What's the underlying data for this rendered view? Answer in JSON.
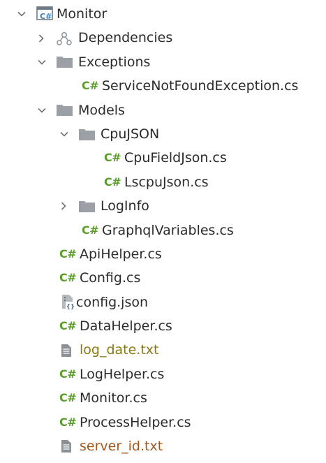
{
  "tree": {
    "root": {
      "label": "Monitor",
      "icon": "csharp-project-icon",
      "expanded": true
    },
    "dependencies": {
      "label": "Dependencies",
      "icon": "dependencies-icon",
      "expanded": false
    },
    "exceptions": {
      "label": "Exceptions",
      "icon": "folder-icon",
      "expanded": true,
      "children": [
        {
          "label": "ServiceNotFoundException.cs",
          "icon": "csharp-file-icon",
          "icon_text": "C#"
        }
      ]
    },
    "models": {
      "label": "Models",
      "icon": "folder-icon",
      "expanded": true,
      "cpujson": {
        "label": "CpuJSON",
        "icon": "folder-icon",
        "expanded": true,
        "children": [
          {
            "label": "CpuFieldJson.cs",
            "icon": "csharp-file-icon",
            "icon_text": "C#"
          },
          {
            "label": "LscpuJson.cs",
            "icon": "csharp-file-icon",
            "icon_text": "C#"
          }
        ]
      },
      "loginfo": {
        "label": "LogInfo",
        "icon": "folder-icon",
        "expanded": false
      },
      "graphql": {
        "label": "GraphqlVariables.cs",
        "icon": "csharp-file-icon",
        "icon_text": "C#"
      }
    },
    "files": [
      {
        "label": "ApiHelper.cs",
        "icon": "csharp-file-icon",
        "icon_text": "C#"
      },
      {
        "label": "Config.cs",
        "icon": "csharp-file-icon",
        "icon_text": "C#"
      },
      {
        "label": "config.json",
        "icon": "json-file-icon"
      },
      {
        "label": "DataHelper.cs",
        "icon": "csharp-file-icon",
        "icon_text": "C#"
      },
      {
        "label": "log_date.txt",
        "icon": "text-file-icon",
        "status_color": "#8a7a16"
      },
      {
        "label": "LogHelper.cs",
        "icon": "csharp-file-icon",
        "icon_text": "C#"
      },
      {
        "label": "Monitor.cs",
        "icon": "csharp-file-icon",
        "icon_text": "C#"
      },
      {
        "label": "ProcessHelper.cs",
        "icon": "csharp-file-icon",
        "icon_text": "C#"
      },
      {
        "label": "server_id.txt",
        "icon": "text-file-icon",
        "status_color": "#a1581c"
      }
    ]
  },
  "colors": {
    "csharp_icon": "#5a9e28",
    "folder": "#9aa0a6",
    "text": "#2b2b2b",
    "arrow": "#6f737a"
  }
}
